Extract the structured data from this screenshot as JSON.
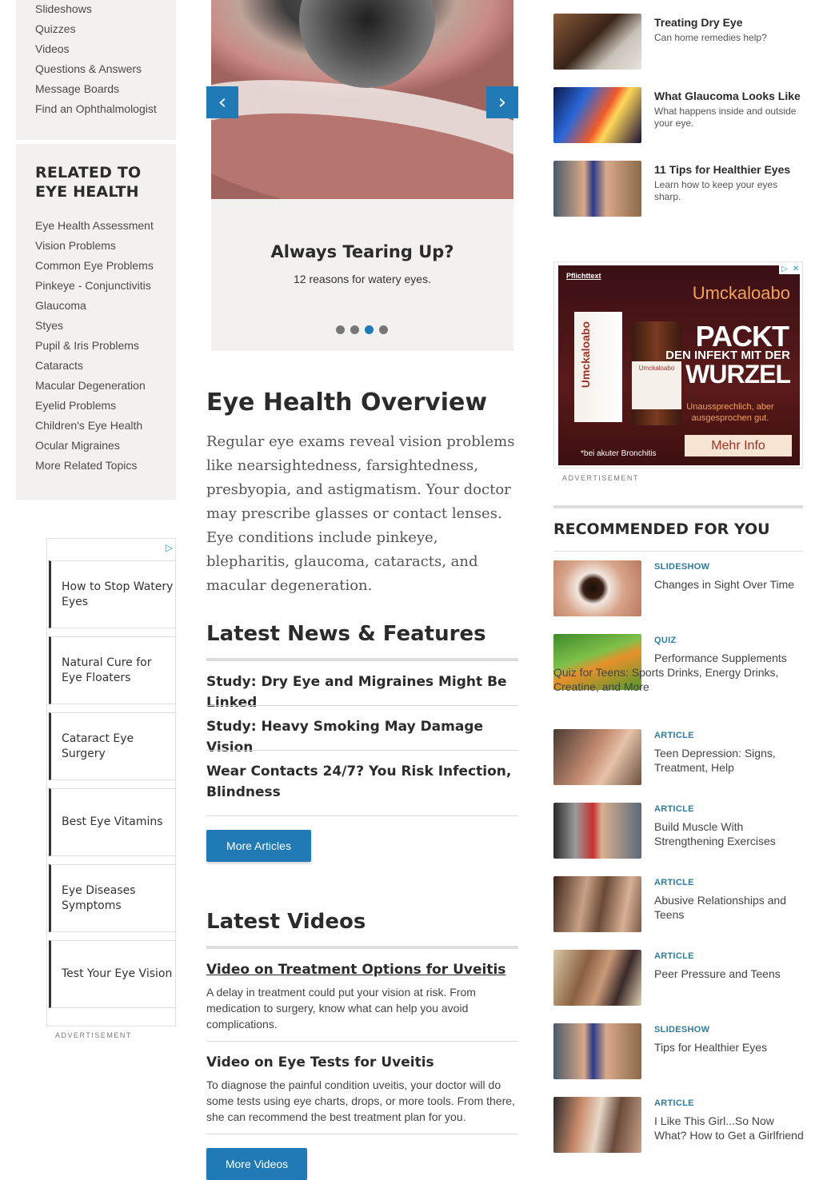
{
  "left_nav_top": {
    "items": [
      "Slideshows",
      "Quizzes",
      "Videos",
      "Questions & Answers",
      "Message Boards",
      "Find an Ophthalmologist"
    ]
  },
  "left_nav_related": {
    "heading_line1": "RELATED TO",
    "heading_line2": "EYE HEALTH",
    "items": [
      "Eye Health Assessment",
      "Vision Problems",
      "Common Eye Problems",
      "Pinkeye - Conjunctivitis",
      "Glaucoma",
      "Styes",
      "Pupil & Iris Problems",
      "Cataracts",
      "Macular Degeneration",
      "Eyelid Problems",
      "Children's Eye Health",
      "Ocular Migraines",
      "More Related Topics"
    ]
  },
  "left_ad": {
    "links": [
      "How to Stop Watery Eyes",
      "Natural Cure for Eye Floaters",
      "Cataract Eye Surgery",
      "Best Eye Vitamins",
      "Eye Diseases Symptoms",
      "Test Your Eye Vision"
    ],
    "label": "ADVERTISEMENT"
  },
  "carousel": {
    "title": "Always Tearing Up?",
    "subtitle": "12 reasons for watery eyes.",
    "prev": "‹",
    "next": "›",
    "dots": 4,
    "active_dot": 3
  },
  "overview": {
    "heading": "Eye Health Overview",
    "text": "Regular eye exams reveal vision problems like nearsightedness, farsightedness, presbyopia, and astigmatism. Your doctor may prescribe glasses or contact lenses. Eye conditions include pinkeye, blepharitis, glaucoma, cataracts, and macular degeneration."
  },
  "news": {
    "heading": "Latest News & Features",
    "items": [
      "Study: Dry Eye and Migraines Might Be Linked",
      "Study: Heavy Smoking May Damage Vision",
      "Wear Contacts 24/7? You Risk Infection, Blindness"
    ],
    "button": "More Articles"
  },
  "videos": {
    "heading": "Latest Videos",
    "items": [
      {
        "title": "Video on Treatment Options for Uveitis",
        "desc": "A delay in treatment could put your vision at risk. From medication to surgery, know what can help you avoid complications."
      },
      {
        "title": "Video on Eye Tests for Uveitis",
        "desc": "To diagnose the painful condition uveitis, your doctor will do some tests using eye charts, drops, or more tools. From there, she can recommend the best treatment plan for you."
      }
    ],
    "button": "More Videos"
  },
  "right_top": [
    {
      "title": "Treating Dry Eye",
      "sub": "Can home remedies help?"
    },
    {
      "title": "What Glaucoma Looks Like",
      "sub": "What happens inside and outside your eye."
    },
    {
      "title": "11 Tips for Healthier Eyes",
      "sub": "Learn how to keep your eyes sharp."
    }
  ],
  "display_ad": {
    "small": "Pflichttext",
    "brand": "Umckaloabo",
    "line1": "PACKT",
    "line2": "DEN INFEKT MIT DER",
    "line3": "WURZEL",
    "tagline": "Unaussprechlich, aber ausgesprochen gut.",
    "cta": "Mehr Info",
    "footnote": "*bei akuter Bronchitis",
    "box_label": "Umckaloabo",
    "bottle_label": "Umckaloabo",
    "label": "ADVERTISEMENT"
  },
  "recommended": {
    "heading": "RECOMMENDED FOR YOU",
    "items": [
      {
        "type": "SLIDESHOW",
        "title": "Changes in Sight Over Time"
      },
      {
        "type": "QUIZ",
        "title": "Performance Supplements Quiz for Teens: Sports Drinks, Energy Drinks, Creatine, and More"
      },
      {
        "type": "ARTICLE",
        "title": "Teen Depression: Signs, Treatment, Help"
      },
      {
        "type": "ARTICLE",
        "title": "Build Muscle With Strengthening Exercises"
      },
      {
        "type": "ARTICLE",
        "title": "Abusive Relationships and Teens"
      },
      {
        "type": "ARTICLE",
        "title": "Peer Pressure and Teens"
      },
      {
        "type": "SLIDESHOW",
        "title": "Tips for Healthier Eyes"
      },
      {
        "type": "ARTICLE",
        "title": "I Like This Girl...So Now What? How to Get a Girlfriend"
      }
    ]
  },
  "colors": {
    "accent": "#1f7ab5",
    "sidebar_bg": "#f2f1ef",
    "type_label": "#2e7d9a"
  }
}
